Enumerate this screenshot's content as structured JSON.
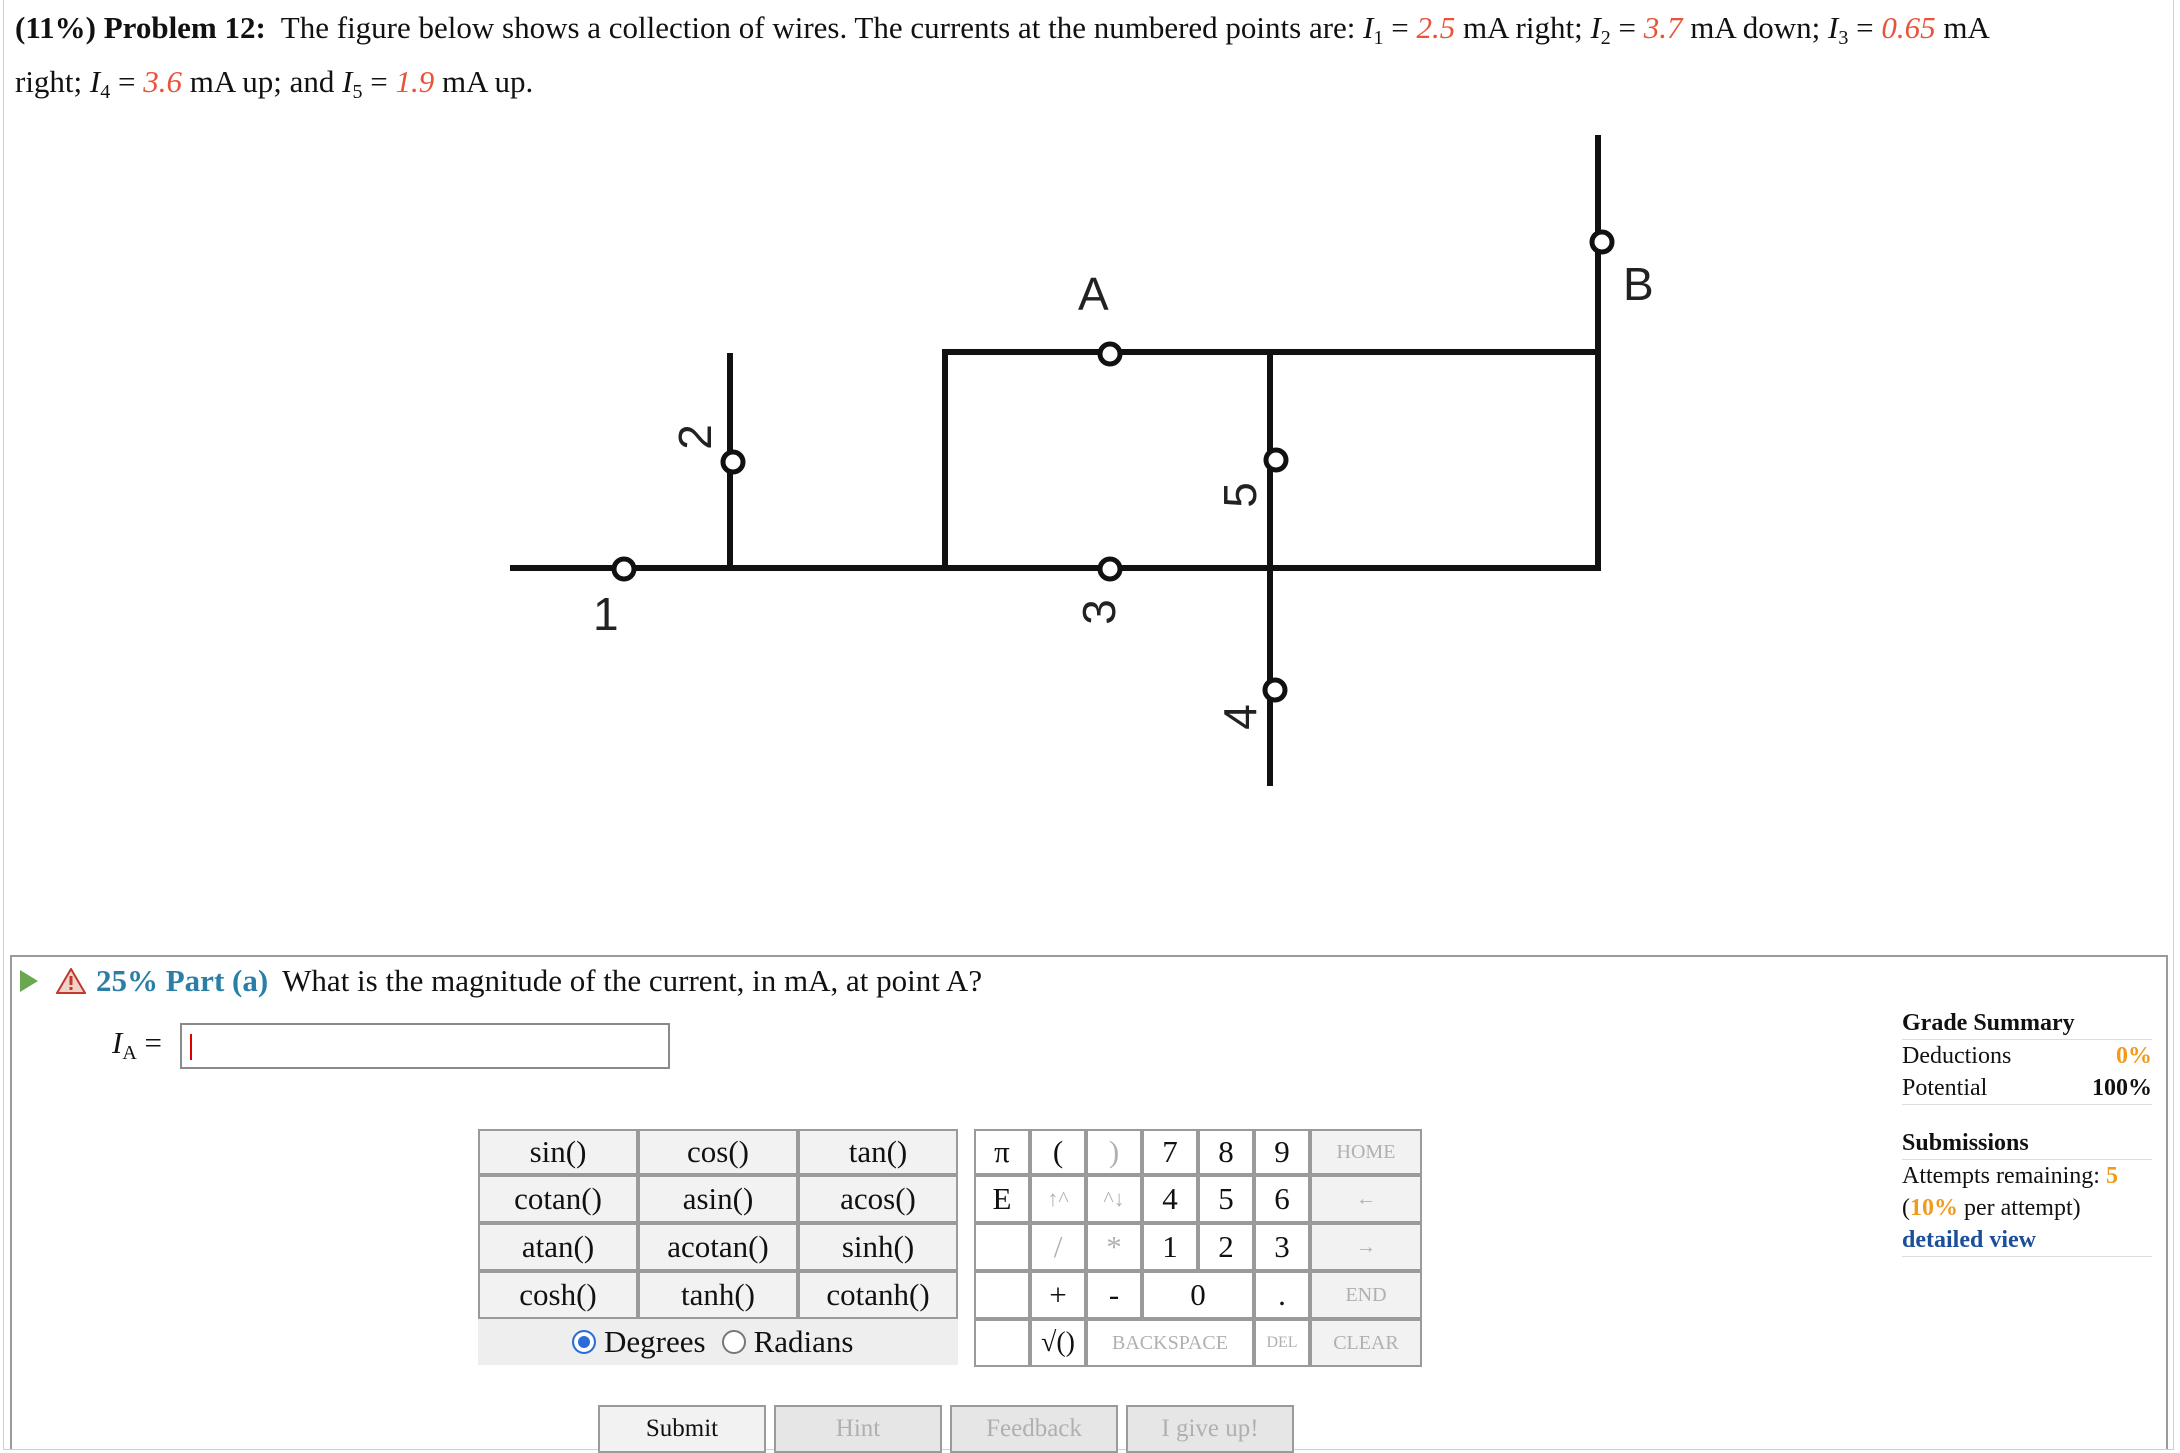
{
  "problem": {
    "percent": "(11%)",
    "title": "Problem 12:",
    "intro": "The figure below shows a collection of wires. The currents at the numbered points are:",
    "currents": [
      {
        "label": "I",
        "sub": "1",
        "value": "2.5",
        "unit": "mA right;"
      },
      {
        "label": "I",
        "sub": "2",
        "value": "3.7",
        "unit": "mA down;"
      },
      {
        "label": "I",
        "sub": "3",
        "value": "0.65",
        "unit": "mA"
      },
      {
        "label": "I",
        "sub": "4",
        "value": "3.6",
        "unit": "mA up; and"
      },
      {
        "label": "I",
        "sub": "5",
        "value": "1.9",
        "unit": "mA up."
      }
    ],
    "line2_prefix": "right;"
  },
  "figure": {
    "labels": {
      "A": "A",
      "B": "B",
      "p1": "1",
      "p2": "2",
      "p3": "3",
      "p4": "4",
      "p5": "5"
    }
  },
  "part": {
    "percent": "25%",
    "name": "Part (a)",
    "question": "What is the magnitude of the current, in mA, at point A?",
    "answer_label": "I",
    "answer_sub": "A",
    "answer_eq": "=",
    "answer_value": ""
  },
  "calculator": {
    "functions": [
      [
        "sin()",
        "cos()",
        "tan()"
      ],
      [
        "cotan()",
        "asin()",
        "acos()"
      ],
      [
        "atan()",
        "acotan()",
        "sinh()"
      ],
      [
        "cosh()",
        "tanh()",
        "cotanh()"
      ]
    ],
    "degrees": "Degrees",
    "radians": "Radians",
    "pi": "π",
    "e": "E",
    "open_paren": "(",
    "close_paren": ")",
    "up": "↑^",
    "down": "^↓",
    "divide": "/",
    "multiply": "*",
    "plus": "+",
    "minus": "-",
    "sqrt": "√()",
    "digits_row1": [
      "7",
      "8",
      "9"
    ],
    "digits_row2": [
      "4",
      "5",
      "6"
    ],
    "digits_row3": [
      "1",
      "2",
      "3"
    ],
    "zero": "0",
    "dot": ".",
    "home": "HOME",
    "left": "←",
    "right": "→",
    "end": "END",
    "backspace": "BACKSPACE",
    "del": "DEL",
    "clear": "CLEAR"
  },
  "actions": {
    "submit": "Submit",
    "hint": "Hint",
    "feedback": "Feedback",
    "giveup": "I give up!"
  },
  "grade_summary": {
    "title": "Grade Summary",
    "deductions_label": "Deductions",
    "deductions_value": "0%",
    "potential_label": "Potential",
    "potential_value": "100%",
    "submissions_title": "Submissions",
    "attempts_label": "Attempts remaining:",
    "attempts_value": "5",
    "per_attempt_pct": "10%",
    "per_attempt_text": "per attempt)",
    "detailed": "detailed view"
  },
  "colors": {
    "value": "#e8543a",
    "part_accent": "#2a7fa7",
    "grade_accent": "#f29a1b",
    "link": "#1b4f9a"
  }
}
